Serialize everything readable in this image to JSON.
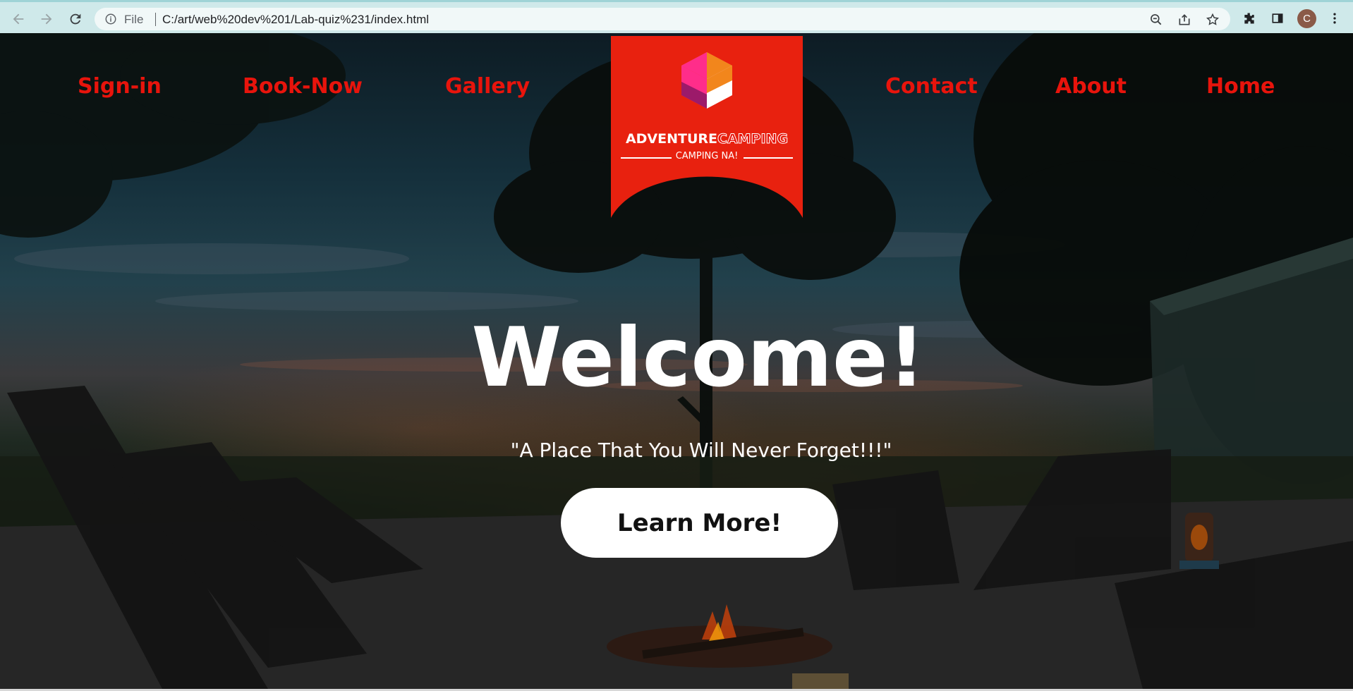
{
  "browser": {
    "omnibox_scheme_label": "File",
    "url": "C:/art/web%20dev%201/Lab-quiz%231/index.html",
    "avatar_initial": "C",
    "icons": [
      "back-icon",
      "forward-icon",
      "reload-icon",
      "info-icon",
      "zoom-out-icon",
      "share-icon",
      "bookmark-star-icon",
      "extensions-icon",
      "side-panel-icon",
      "avatar",
      "more-menu-icon"
    ]
  },
  "site": {
    "nav_left": [
      "Sign-in",
      "Book-Now",
      "Gallery"
    ],
    "nav_right": [
      "Contact",
      "About",
      "Home"
    ],
    "logo": {
      "title_part1": "ADVENTURE",
      "title_part2": "CAMPING",
      "tagline": "CAMPING NA!",
      "colors": {
        "background": "#e8210f",
        "cube_pink": "#ff2d8a",
        "cube_orange": "#f2861c",
        "cube_purple": "#9c1a6a",
        "cube_white": "#ffffff"
      }
    },
    "hero": {
      "title": "Welcome!",
      "subtitle": "\"A Place That You Will Never Forget!!!\"",
      "cta_label": "Learn More!"
    },
    "colors": {
      "nav_link": "#e8140c",
      "text": "#ffffff",
      "button_bg": "#ffffff"
    }
  }
}
